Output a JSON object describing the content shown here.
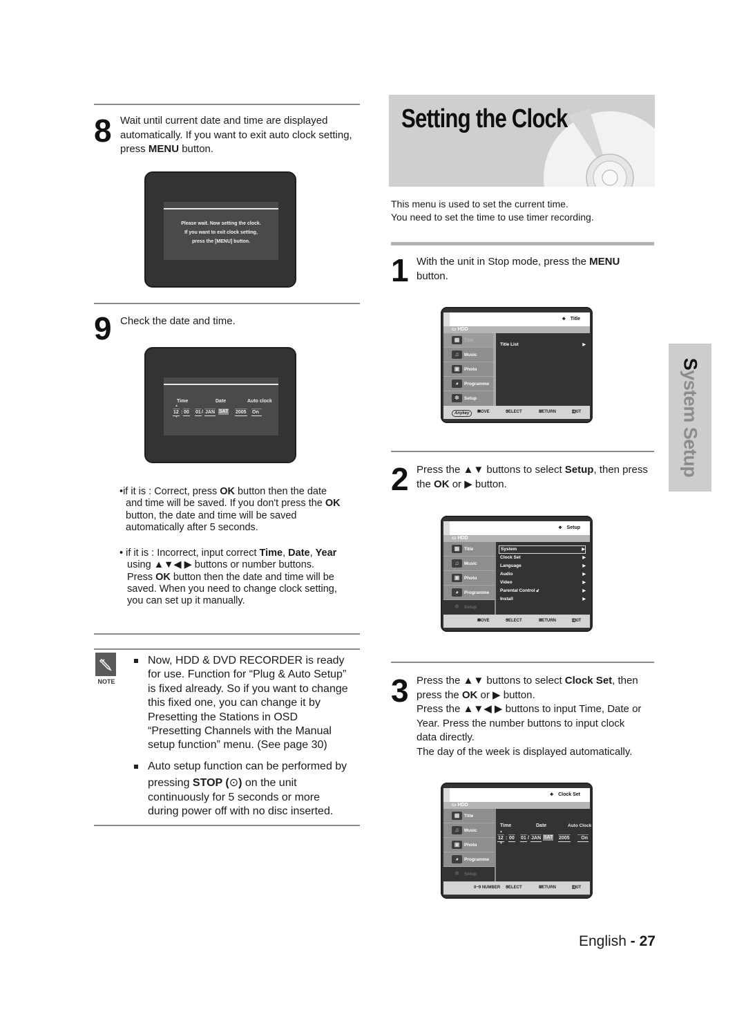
{
  "page": {
    "section_title": "Setting the Clock",
    "side_tab": "System Setup",
    "side_tab_first_letter": "S",
    "side_tab_rest": "ystem Setup",
    "footer_language": "English",
    "footer_separator": " - ",
    "footer_page_number": "27"
  },
  "intro": {
    "line1": "This menu is used to set the current time.",
    "line2": "You need to set the time to use timer recording."
  },
  "left": {
    "step8": {
      "number": "8",
      "line1": "Wait until current date and time are displayed",
      "line2": "automatically. If you want to exit auto clock setting,",
      "line3_pre": "press ",
      "line3_bold": "MENU",
      "line3_post": " button.",
      "screen": {
        "msg1": "Please wait. Now setting the clock.",
        "msg2": "If you want to exit clock setting,",
        "msg3": "press the [MENU] button."
      }
    },
    "step9": {
      "number": "9",
      "text": "Check the date and time.",
      "screen": {
        "label_time": "Time",
        "label_date": "Date",
        "label_auto": "Auto clock",
        "hour": "12",
        "minute": "00",
        "day": "01",
        "month": "JAN",
        "weekday": "SAT",
        "year": "2005",
        "auto": "On"
      }
    },
    "bullets": [
      {
        "lines": [
          [
            "•if it is : Correct, press ",
            "OK",
            " button then the date"
          ],
          [
            "and time will be saved. If you don't press the ",
            "OK",
            ""
          ],
          [
            "button, the date and time will be saved",
            "",
            ""
          ],
          [
            "automatically after 5 seconds.",
            "",
            ""
          ]
        ]
      },
      {
        "lines": [
          [
            "• if it is : Incorrect, input correct ",
            "Time",
            ", "
          ],
          [
            "using ▲▼◀ ▶ buttons or number buttons.",
            "",
            ""
          ],
          [
            "Press ",
            "OK",
            " button then the date and time will be"
          ],
          [
            "saved. When you need to change clock setting,",
            "",
            ""
          ],
          [
            "you can set up it manually.",
            "",
            ""
          ]
        ],
        "extra_bold_1": "Date",
        "extra_sep": ", ",
        "extra_bold_2": "Year"
      }
    ],
    "note": {
      "label": "NOTE",
      "item1": [
        "Now, HDD & DVD RECORDER is ready",
        "for use. Function for “Plug & Auto Setup”",
        "is fixed already. So if you want to change",
        "this fixed one, you can change it by",
        "Presetting the Stations in OSD",
        "“Presetting Channels with the Manual",
        "setup function” menu. (See page 30)"
      ],
      "item2_line1": "Auto setup function can be performed by",
      "item2_line2_pre": "pressing ",
      "item2_line2_bold": "STOP (",
      "item2_line2_icon": "⊙",
      "item2_line2_bold_close": ")",
      "item2_line2_post": " on the unit",
      "item2_line3": "continuously for 5 seconds or more",
      "item2_line4": "during power off with no disc inserted."
    }
  },
  "right": {
    "step1": {
      "number": "1",
      "line1_pre": "With the unit in Stop mode, press the ",
      "line1_bold": "MENU",
      "line2": "button."
    },
    "step2": {
      "number": "2",
      "line1_pre": "Press the ▲▼ buttons to select ",
      "line1_bold": "Setup",
      "line1_post": ", then press",
      "line2_pre": "the ",
      "line2_bold": "OK",
      "line2_post": " or ▶ button."
    },
    "step3": {
      "number": "3",
      "line1_pre": "Press the ▲▼ buttons to select ",
      "line1_bold": "Clock Set",
      "line1_post": ", then",
      "line2_pre": "press the ",
      "line2_bold": "OK",
      "line2_post": " or ▶ button.",
      "line3": "Press the ▲▼◀ ▶ buttons to input Time, Date or",
      "line4": "Year. Press the number buttons to input clock",
      "line5": "data directly.",
      "line6": "The day of the week is displayed automatically."
    }
  },
  "osd": {
    "hdd_label": "HDD",
    "side_items": [
      "Title",
      "Music",
      "Photo",
      "Programme",
      "Setup"
    ],
    "footer": {
      "anykey": "Anykey",
      "move": "MOVE",
      "select": "SELECT",
      "return": "RETURN",
      "exit": "EXIT",
      "number": "0~9 NUMBER"
    },
    "menu1": {
      "crumb": "Title",
      "rows": [
        {
          "label": "Title List",
          "arrow": "▶"
        }
      ]
    },
    "menu2": {
      "crumb": "Setup",
      "rows": [
        {
          "label": "System",
          "arrow": "▶"
        },
        {
          "label": "Clock Set",
          "arrow": "▶"
        },
        {
          "label": "Language",
          "arrow": "▶"
        },
        {
          "label": "Audio",
          "arrow": "▶"
        },
        {
          "label": "Video",
          "arrow": "▶"
        },
        {
          "label": "Parental Control",
          "arrow": "▶"
        },
        {
          "label": "Install",
          "arrow": "▶"
        }
      ]
    },
    "menu3": {
      "crumb": "Clock Set",
      "label_time": "Time",
      "label_date": "Date",
      "label_auto": "Auto Clock",
      "hour": "12",
      "minute": "00",
      "day": "01",
      "month": "JAN",
      "weekday": "SAT",
      "year": "2005",
      "auto": "On"
    }
  }
}
